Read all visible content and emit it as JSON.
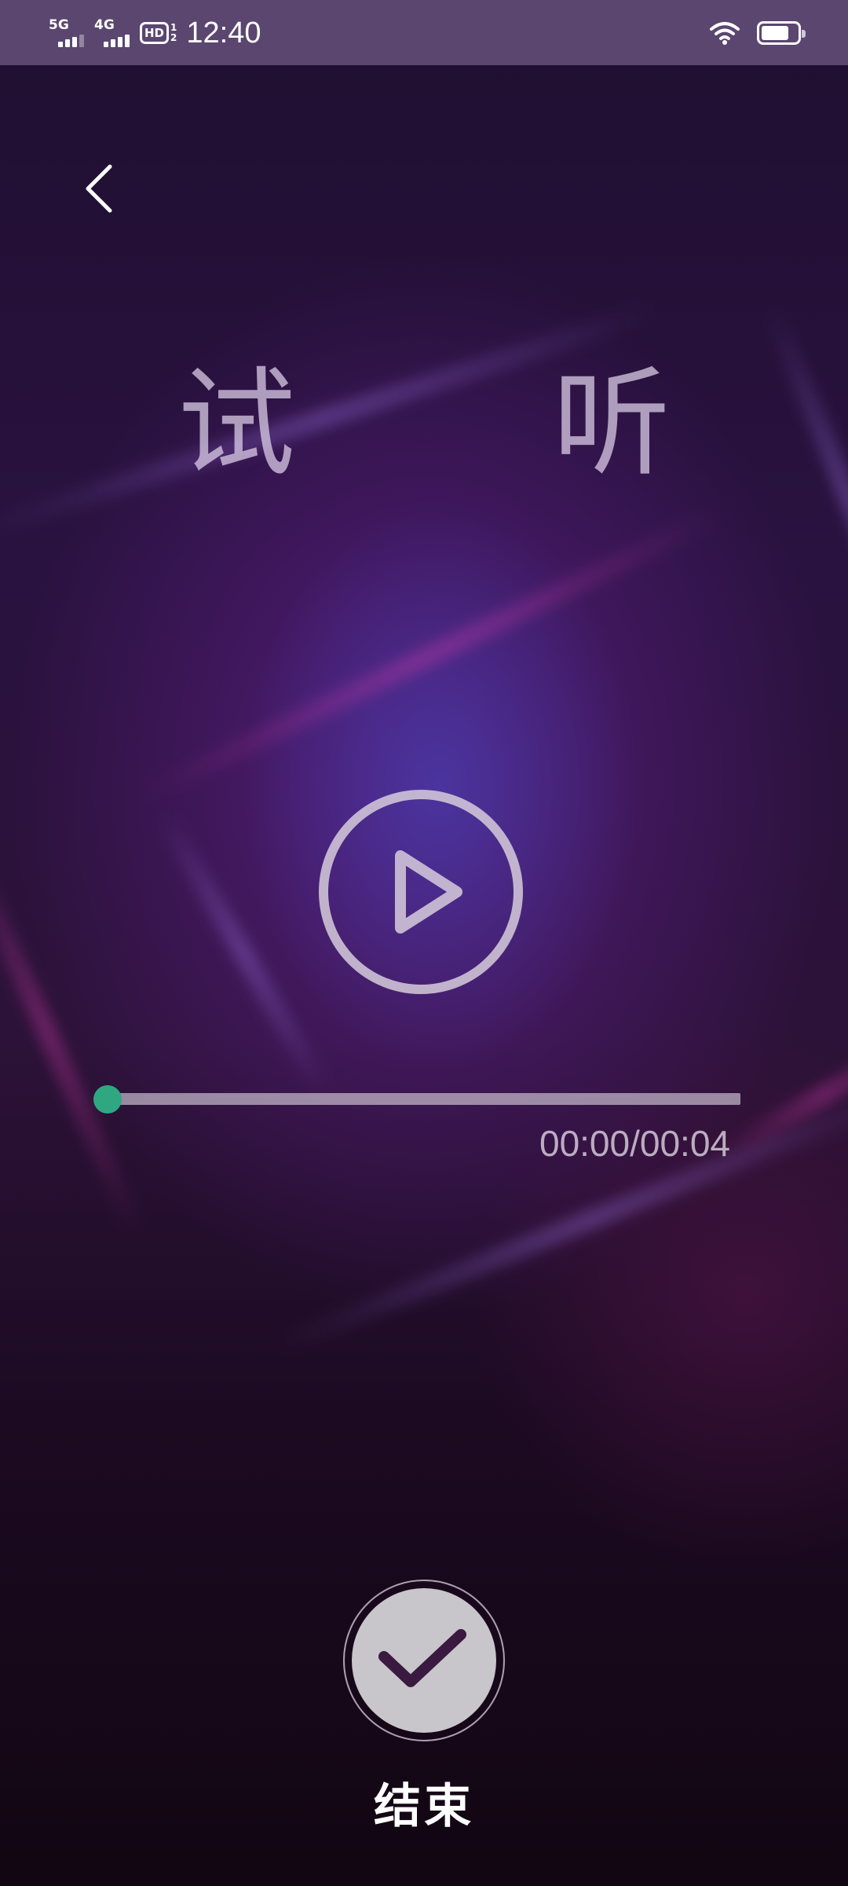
{
  "status_bar": {
    "network1": "5G",
    "network2": "4G",
    "hd_label": "HD",
    "hd_sub_top": "1",
    "hd_sub_bottom": "2",
    "time": "12:40",
    "battery_level": 0.78
  },
  "page": {
    "title": "试 听",
    "time_display": "00:00/00:04",
    "progress": 0,
    "finish_label": "结束"
  },
  "colors": {
    "accent": "#2fa882",
    "status_bar_bg": "#5b4670",
    "check_color": "#3a1a40"
  },
  "icons": {
    "back": "chevron-left-icon",
    "play": "play-circle-icon",
    "finish": "check-circle-icon",
    "wifi": "wifi-icon",
    "battery": "battery-icon"
  }
}
